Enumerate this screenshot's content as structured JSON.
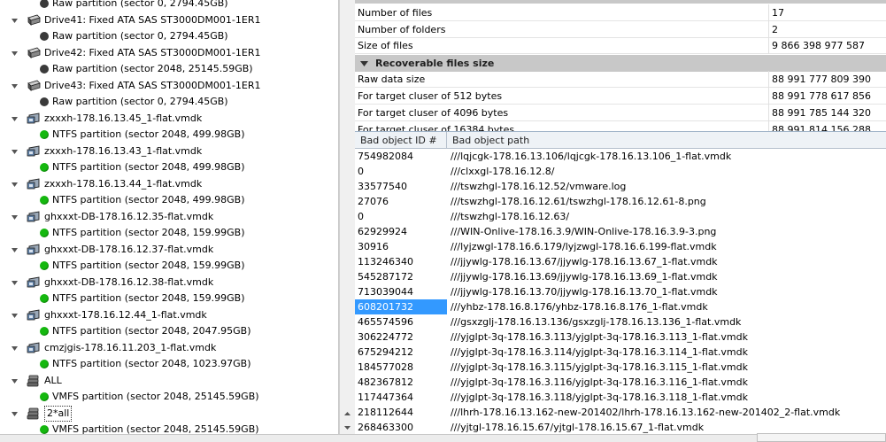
{
  "tree": [
    {
      "label": "Raw partition (sector 0, 2794.45GB)",
      "level": 1,
      "icon": "dark-dot-icon"
    },
    {
      "label": "Drive41: Fixed ATA SAS ST3000DM001-1ER1",
      "level": 0,
      "icon": "hard-drive-icon"
    },
    {
      "label": "Raw partition (sector 0, 2794.45GB)",
      "level": 1,
      "icon": "dark-dot-icon"
    },
    {
      "label": "Drive42: Fixed ATA SAS ST3000DM001-1ER1",
      "level": 0,
      "icon": "hard-drive-icon"
    },
    {
      "label": "Raw partition (sector 2048, 25145.59GB)",
      "level": 1,
      "icon": "dark-dot-icon"
    },
    {
      "label": "Drive43: Fixed ATA SAS ST3000DM001-1ER1",
      "level": 0,
      "icon": "hard-drive-icon"
    },
    {
      "label": "Raw partition (sector 0, 2794.45GB)",
      "level": 1,
      "icon": "dark-dot-icon"
    },
    {
      "label": "zxxxh-178.16.13.45_1-flat.vmdk",
      "level": 0,
      "icon": "virtual-disk-icon"
    },
    {
      "label": "NTFS partition (sector 2048, 499.98GB)",
      "level": 1,
      "icon": "green-dot-icon"
    },
    {
      "label": "zxxxh-178.16.13.43_1-flat.vmdk",
      "level": 0,
      "icon": "virtual-disk-icon"
    },
    {
      "label": "NTFS partition (sector 2048, 499.98GB)",
      "level": 1,
      "icon": "green-dot-icon"
    },
    {
      "label": "zxxxh-178.16.13.44_1-flat.vmdk",
      "level": 0,
      "icon": "virtual-disk-icon"
    },
    {
      "label": "NTFS partition (sector 2048, 499.98GB)",
      "level": 1,
      "icon": "green-dot-icon"
    },
    {
      "label": "ghxxxt-DB-178.16.12.35-flat.vmdk",
      "level": 0,
      "icon": "virtual-disk-icon"
    },
    {
      "label": "NTFS partition (sector 2048, 159.99GB)",
      "level": 1,
      "icon": "green-dot-icon"
    },
    {
      "label": "ghxxxt-DB-178.16.12.37-flat.vmdk",
      "level": 0,
      "icon": "virtual-disk-icon"
    },
    {
      "label": "NTFS partition (sector 2048, 159.99GB)",
      "level": 1,
      "icon": "green-dot-icon"
    },
    {
      "label": "ghxxxt-DB-178.16.12.38-flat.vmdk",
      "level": 0,
      "icon": "virtual-disk-icon"
    },
    {
      "label": "NTFS partition (sector 2048, 159.99GB)",
      "level": 1,
      "icon": "green-dot-icon"
    },
    {
      "label": "ghxxxt-178.16.12.44_1-flat.vmdk",
      "level": 0,
      "icon": "virtual-disk-icon"
    },
    {
      "label": "NTFS partition (sector 2048, 2047.95GB)",
      "level": 1,
      "icon": "green-dot-icon"
    },
    {
      "label": "cmzjgis-178.16.11.203_1-flat.vmdk",
      "level": 0,
      "icon": "virtual-disk-icon"
    },
    {
      "label": "NTFS partition (sector 2048, 1023.97GB)",
      "level": 1,
      "icon": "green-dot-icon"
    },
    {
      "label": "ALL",
      "level": 0,
      "icon": "raid-stack-icon"
    },
    {
      "label": "VMFS partition (sector 2048, 25145.59GB)",
      "level": 1,
      "icon": "green-dot-icon"
    },
    {
      "label": "2*all",
      "level": 0,
      "icon": "raid-stack-icon",
      "selected": true
    },
    {
      "label": "VMFS partition (sector 2048, 25145.59GB)",
      "level": 1,
      "icon": "green-dot-icon"
    }
  ],
  "props": {
    "rows_top": [
      {
        "key": "Number of files",
        "value": "17"
      },
      {
        "key": "Number of folders",
        "value": "2"
      },
      {
        "key": "Size of files",
        "value": "9 866 398 977 587"
      }
    ],
    "section_title": "Recoverable files size",
    "rows_bottom": [
      {
        "key": "Raw data size",
        "value": "88 991 777 809 390"
      },
      {
        "key": "For target cluser of 512 bytes",
        "value": "88 991 778 617 856"
      },
      {
        "key": "For target cluser of 4096 bytes",
        "value": "88 991 785 144 320"
      },
      {
        "key": "For target cluser of 16384 bytes",
        "value": "88 991 814 156 288"
      }
    ]
  },
  "list": {
    "columns": [
      "Bad object ID #",
      "Bad object path"
    ],
    "rows": [
      {
        "id": "754982084",
        "path": "///lqjcgk-178.16.13.106/lqjcgk-178.16.13.106_1-flat.vmdk"
      },
      {
        "id": "0",
        "path": "///clxxgl-178.16.12.8/"
      },
      {
        "id": "33577540",
        "path": "///tswzhgl-178.16.12.52/vmware.log"
      },
      {
        "id": "27076",
        "path": "///tswzhgl-178.16.12.61/tswzhgl-178.16.12.61-8.png"
      },
      {
        "id": "0",
        "path": "///tswzhgl-178.16.12.63/"
      },
      {
        "id": "62929924",
        "path": "///WIN-Onlive-178.16.3.9/WIN-Onlive-178.16.3.9-3.png"
      },
      {
        "id": "30916",
        "path": "///lyjzwgl-178.16.6.179/lyjzwgl-178.16.6.199-flat.vmdk"
      },
      {
        "id": "113246340",
        "path": "///jjywlg-178.16.13.67/jjywlg-178.16.13.67_1-flat.vmdk"
      },
      {
        "id": "545287172",
        "path": "///jjywlg-178.16.13.69/jjywlg-178.16.13.69_1-flat.vmdk"
      },
      {
        "id": "713039044",
        "path": "///jjywlg-178.16.13.70/jjywlg-178.16.13.70_1-flat.vmdk"
      },
      {
        "id": "608201732",
        "path": "///yhbz-178.16.8.176/yhbz-178.16.8.176_1-flat.vmdk",
        "selected": true
      },
      {
        "id": "465574596",
        "path": "///gsxzglj-178.16.13.136/gsxzglj-178.16.13.136_1-flat.vmdk"
      },
      {
        "id": "306224772",
        "path": "///yjglpt-3q-178.16.3.113/yjglpt-3q-178.16.3.113_1-flat.vmdk"
      },
      {
        "id": "675294212",
        "path": "///yjglpt-3q-178.16.3.114/yjglpt-3q-178.16.3.114_1-flat.vmdk"
      },
      {
        "id": "184577028",
        "path": "///yjglpt-3q-178.16.3.115/yjglpt-3q-178.16.3.115_1-flat.vmdk"
      },
      {
        "id": "482367812",
        "path": "///yjglpt-3q-178.16.3.116/yjglpt-3q-178.16.3.116_1-flat.vmdk"
      },
      {
        "id": "117447364",
        "path": "///yjglpt-3q-178.16.3.118/yjglpt-3q-178.16.3.118_1-flat.vmdk"
      },
      {
        "id": "218112644",
        "path": "///lhrh-178.16.13.162-new-201402/lhrh-178.16.13.162-new-201402_2-flat.vmdk"
      },
      {
        "id": "268463300",
        "path": "///yjtgl-178.16.15.67/yjtgl-178.16.15.67_1-flat.vmdk"
      }
    ]
  },
  "colors": {
    "selection": "#3399ff",
    "section_header": "#c8c8c8",
    "partition_ok": "#15b80f",
    "partition_raw": "#3a3a3a"
  }
}
